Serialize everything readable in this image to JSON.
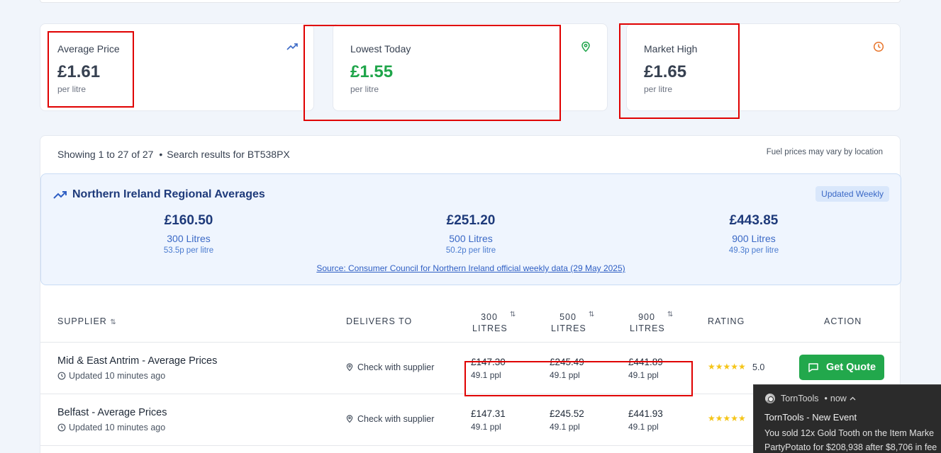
{
  "stats": [
    {
      "label": "Average Price",
      "value": "£1.61",
      "unit": "per litre",
      "icon": "trending-up-icon"
    },
    {
      "label": "Lowest Today",
      "value": "£1.55",
      "unit": "per litre",
      "icon": "map-pin-icon"
    },
    {
      "label": "Market High",
      "value": "£1.65",
      "unit": "per litre",
      "icon": "clock-icon"
    }
  ],
  "results": {
    "showing": "Showing 1 to 27 of 27",
    "separator": "•",
    "search_text": "Search results for BT538PX",
    "note": "Fuel prices may vary by location"
  },
  "regional": {
    "title": "Northern Ireland Regional Averages",
    "badge": "Updated Weekly",
    "averages": [
      {
        "amount": "£160.50",
        "litres": "300 Litres",
        "ppl": "53.5p per litre"
      },
      {
        "amount": "£251.20",
        "litres": "500 Litres",
        "ppl": "50.2p per litre"
      },
      {
        "amount": "£443.85",
        "litres": "900 Litres",
        "ppl": "49.3p per litre"
      }
    ],
    "source": "Source: Consumer Council for Northern Ireland official weekly data (29 May 2025)"
  },
  "table": {
    "headers": {
      "supplier": "SUPPLIER",
      "delivers_to": "DELIVERS TO",
      "l300_a": "300",
      "l300_b": "LITRES",
      "l500_a": "500",
      "l500_b": "LITRES",
      "l900_a": "900",
      "l900_b": "LITRES",
      "rating": "RATING",
      "action": "ACTION"
    },
    "rows": [
      {
        "name": "Mid & East Antrim - Average Prices",
        "updated": "Updated 10 minutes ago",
        "delivers": "Check with supplier",
        "p300": "£147.30",
        "ppl300": "49.1 ppl",
        "p500": "£245.49",
        "ppl500": "49.1 ppl",
        "p900": "£441.89",
        "ppl900": "49.1 ppl",
        "stars": "★★★★★",
        "rating": "5.0",
        "button": "Get Quote"
      },
      {
        "name": "Belfast - Average Prices",
        "updated": "Updated 10 minutes ago",
        "delivers": "Check with supplier",
        "p300": "£147.31",
        "ppl300": "49.1 ppl",
        "p500": "£245.52",
        "ppl500": "49.1 ppl",
        "p900": "£441.93",
        "ppl900": "49.1 ppl",
        "stars": "★★★★★"
      }
    ]
  },
  "notification": {
    "app": "TornTools",
    "dot": "•",
    "time": "now",
    "title": "TornTools - New Event",
    "line1": "You sold 12x Gold Tooth on the Item Marke",
    "line2": "PartyPotato for $208,938 after $8,706 in fee"
  },
  "colors": {
    "accent_green": "#1fa54a",
    "button_green": "#22a84c",
    "regional_title": "#1e3a7a",
    "annotation_red": "#e00000",
    "star": "#f5c518"
  }
}
